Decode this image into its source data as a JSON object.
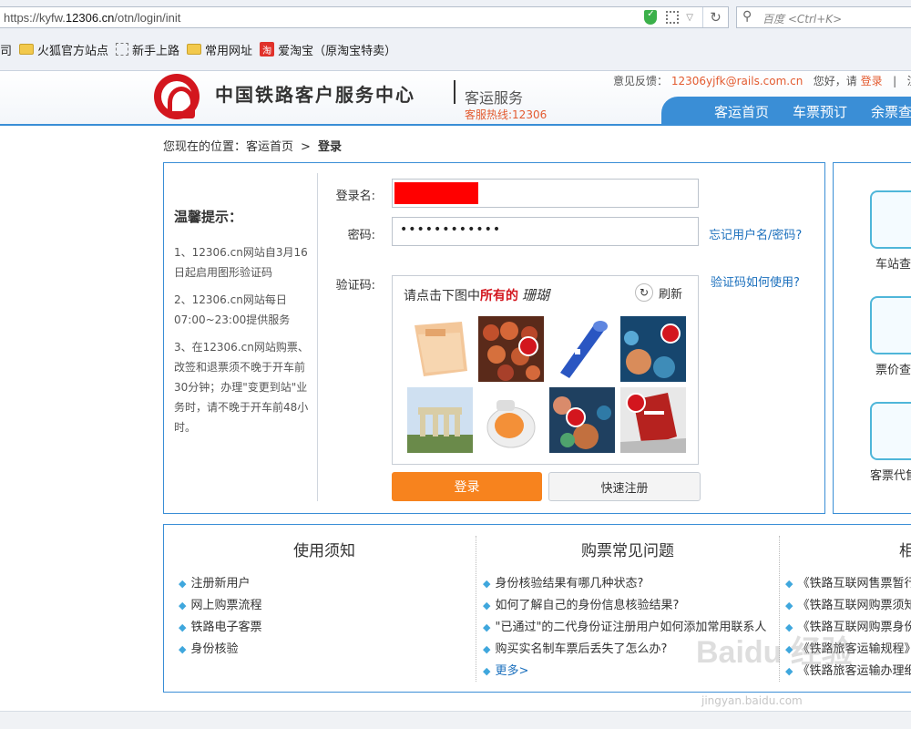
{
  "browser": {
    "url_prefix": "https://kyfw.",
    "url_domain": "12306.cn",
    "url_path": "/otn/login/init",
    "search_placeholder": "百度 <Ctrl+K>",
    "bookmarks": [
      "司",
      "火狐官方站点",
      "新手上路",
      "常用网址",
      "爱淘宝（原淘宝特卖）"
    ],
    "taobao_glyph": "淘"
  },
  "header": {
    "brand": "中国铁路客户服务中心",
    "service": "客运服务",
    "hotline": "客服热线:12306",
    "feedback_label": "意见反馈：",
    "feedback_email": "12306yjfk@rails.com.cn",
    "greeting": "您好，请",
    "login_link": "登录",
    "sep": "|",
    "register_partial": "注",
    "nav": [
      "客运首页",
      "车票预订",
      "余票查"
    ]
  },
  "breadcrumb": {
    "prefix": "您现在的位置：",
    "home": "客运首页",
    "arrow": ">",
    "current": "登录"
  },
  "tips": {
    "title": "温馨提示：",
    "items": [
      "1、12306.cn网站自3月16日起启用图形验证码",
      "2、12306.cn网站每日07:00~23:00提供服务",
      "3、在12306.cn网站购票、改签和退票须不晚于开车前30分钟；办理\"变更到站\"业务时，请不晚于开车前48小时。"
    ]
  },
  "form": {
    "username_label": "登录名:",
    "password_label": "密码:",
    "password_value": "••••••••••••",
    "forgot_link": "忘记用户名/密码?",
    "captcha_label": "验证码:",
    "captcha_help": "验证码如何使用?",
    "captcha_prompt_pre": "请点击下图中",
    "captcha_prompt_red": "所有的",
    "captcha_word": "珊瑚",
    "refresh_label": "刷新",
    "login_button": "登录",
    "register_button": "快速注册"
  },
  "side": {
    "items": [
      "车站查",
      "票价查",
      "客票代售"
    ]
  },
  "info": {
    "col1": {
      "title": "使用须知",
      "items": [
        "注册新用户",
        "网上购票流程",
        "铁路电子客票",
        "身份核验"
      ]
    },
    "col2": {
      "title": "购票常见问题",
      "items": [
        "身份核验结果有哪几种状态?",
        "如何了解自己的身份信息核验结果?",
        "\"已通过\"的二代身份证注册用户如何添加常用联系人",
        "购买实名制车票后丢失了怎么办?"
      ],
      "more": "更多>"
    },
    "col3": {
      "title": "相",
      "items": [
        "《铁路互联网售票暂行",
        "《铁路互联网购票须知",
        "《铁路互联网购票身份",
        "《铁路旅客运输规程》",
        "《铁路旅客运输办理细"
      ]
    }
  },
  "watermark": {
    "main": "Baidu 经验",
    "sub": "jingyan.baidu.com"
  }
}
